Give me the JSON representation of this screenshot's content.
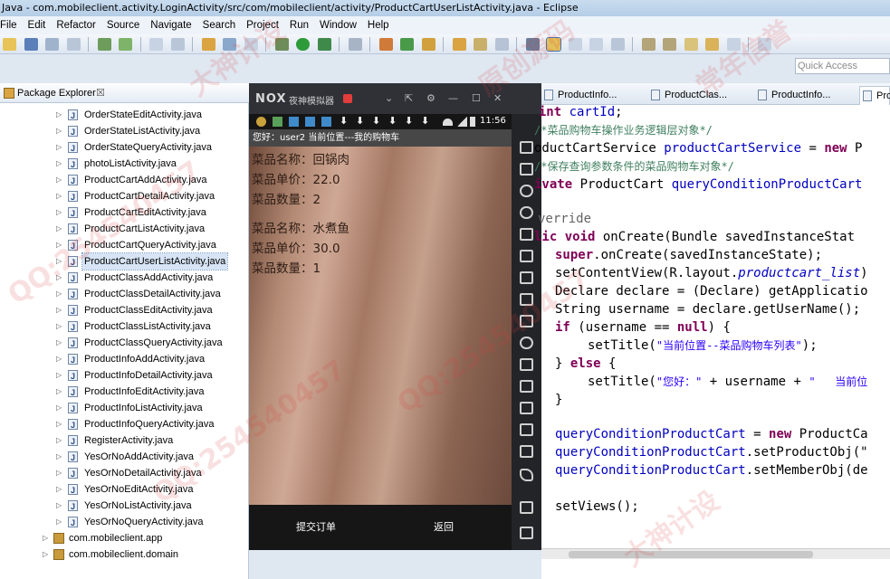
{
  "window": {
    "title": "Java - com.mobileclient.activity.LoginActivity/src/com/mobileclient/activity/ProductCartUserListActivity.java - Eclipse"
  },
  "menu": [
    "File",
    "Edit",
    "Refactor",
    "Source",
    "Navigate",
    "Search",
    "Project",
    "Run",
    "Window",
    "Help"
  ],
  "quick_access": {
    "placeholder": "Quick Access"
  },
  "package_explorer": {
    "tab_label": "Package Explorer",
    "close_glyph": "☒",
    "files": [
      "OrderStateEditActivity.java",
      "OrderStateListActivity.java",
      "OrderStateQueryActivity.java",
      "photoListActivity.java",
      "ProductCartAddActivity.java",
      "ProductCartDetailActivity.java",
      "ProductCartEditActivity.java",
      "ProductCartListActivity.java",
      "ProductCartQueryActivity.java",
      "ProductCartUserListActivity.java",
      "ProductClassAddActivity.java",
      "ProductClassDetailActivity.java",
      "ProductClassEditActivity.java",
      "ProductClassListActivity.java",
      "ProductClassQueryActivity.java",
      "ProductInfoAddActivity.java",
      "ProductInfoDetailActivity.java",
      "ProductInfoEditActivity.java",
      "ProductInfoListActivity.java",
      "ProductInfoQueryActivity.java",
      "RegisterActivity.java",
      "YesOrNoAddActivity.java",
      "YesOrNoDetailActivity.java",
      "YesOrNoEditActivity.java",
      "YesOrNoListActivity.java",
      "YesOrNoQueryActivity.java"
    ],
    "selected_file": "ProductCartUserListActivity.java",
    "packages": [
      "com.mobileclient.app",
      "com.mobileclient.domain"
    ]
  },
  "emulator": {
    "brand": "NOX",
    "title": "夜神模拟器",
    "controls": [
      "⌄",
      "⇱",
      "⚙",
      "—",
      "☐",
      "✕"
    ],
    "clock": "11:56",
    "app_title": "您好：user2  当前位置---我的购物车",
    "items": [
      {
        "name_label": "菜品名称：回锅肉",
        "price_label": "菜品单价：22.0",
        "qty_label": "菜品数量：2"
      },
      {
        "name_label": "菜品名称：水煮鱼",
        "price_label": "菜品单价：30.0",
        "qty_label": "菜品数量：1"
      }
    ],
    "submit_button": "提交订单",
    "back_button": "返回"
  },
  "editor": {
    "tabs": [
      "ProductInfo...",
      "ProductClas...",
      "ProductInfo...",
      "Pro"
    ],
    "active_tab_index": 3,
    "code": {
      "l1_kw": "int ",
      "l1_fld": "cartId",
      "l1_rest": ";",
      "l2": "/*菜品购物车操作业务逻辑层对象*/",
      "l3_a": "oductCartService ",
      "l3_fld": "productCartService",
      "l3_b": " = ",
      "l3_kw": "new",
      "l3_c": " P",
      "l4": "/*保存查询参数条件的菜品购物车对象*/",
      "l5_kw": "ivate",
      "l5_a": " ProductCart ",
      "l5_fld": "queryConditionProductCart",
      "l6": "verride",
      "l7_kw": "lic void",
      "l7_a": " onCreate(Bundle savedInstanceStat",
      "l8_kw": "super",
      "l8_a": ".onCreate(savedInstanceState);",
      "l9_a": "setContentView(R.layout.",
      "l9_fld": "productcart_list",
      "l9_b": ")",
      "l10": "Declare declare = (Declare) getApplicatio",
      "l11": "String username = declare.getUserName();",
      "l12_kw": "if",
      "l12_a": " (username == ",
      "l12_kw2": "null",
      "l12_b": ") {",
      "l13_a": "setTitle(",
      "l13_str": "\"当前位置--菜品购物车列表\"",
      "l13_b": ");",
      "l14_a": "} ",
      "l14_kw": "else",
      "l14_b": " {",
      "l15_a": "setTitle(",
      "l15_str": "\"您好：\"",
      "l15_b": " + username + ",
      "l15_str2": "\"   当前位",
      "l16": "}",
      "l17_fld": "queryConditionProductCart",
      "l17_a": " = ",
      "l17_kw": "new",
      "l17_b": " ProductCa",
      "l18_fld": "queryConditionProductCart",
      "l18_a": ".setProductObj(\"",
      "l19_fld": "queryConditionProductCart",
      "l19_a": ".setMemberObj(de",
      "l20": "setViews();"
    }
  },
  "watermarks": [
    "大神计设",
    "QQ:254540457",
    "原创源码",
    "常年信誉",
    "QQ:254540457",
    "大神计设",
    "QQ:254540457"
  ]
}
